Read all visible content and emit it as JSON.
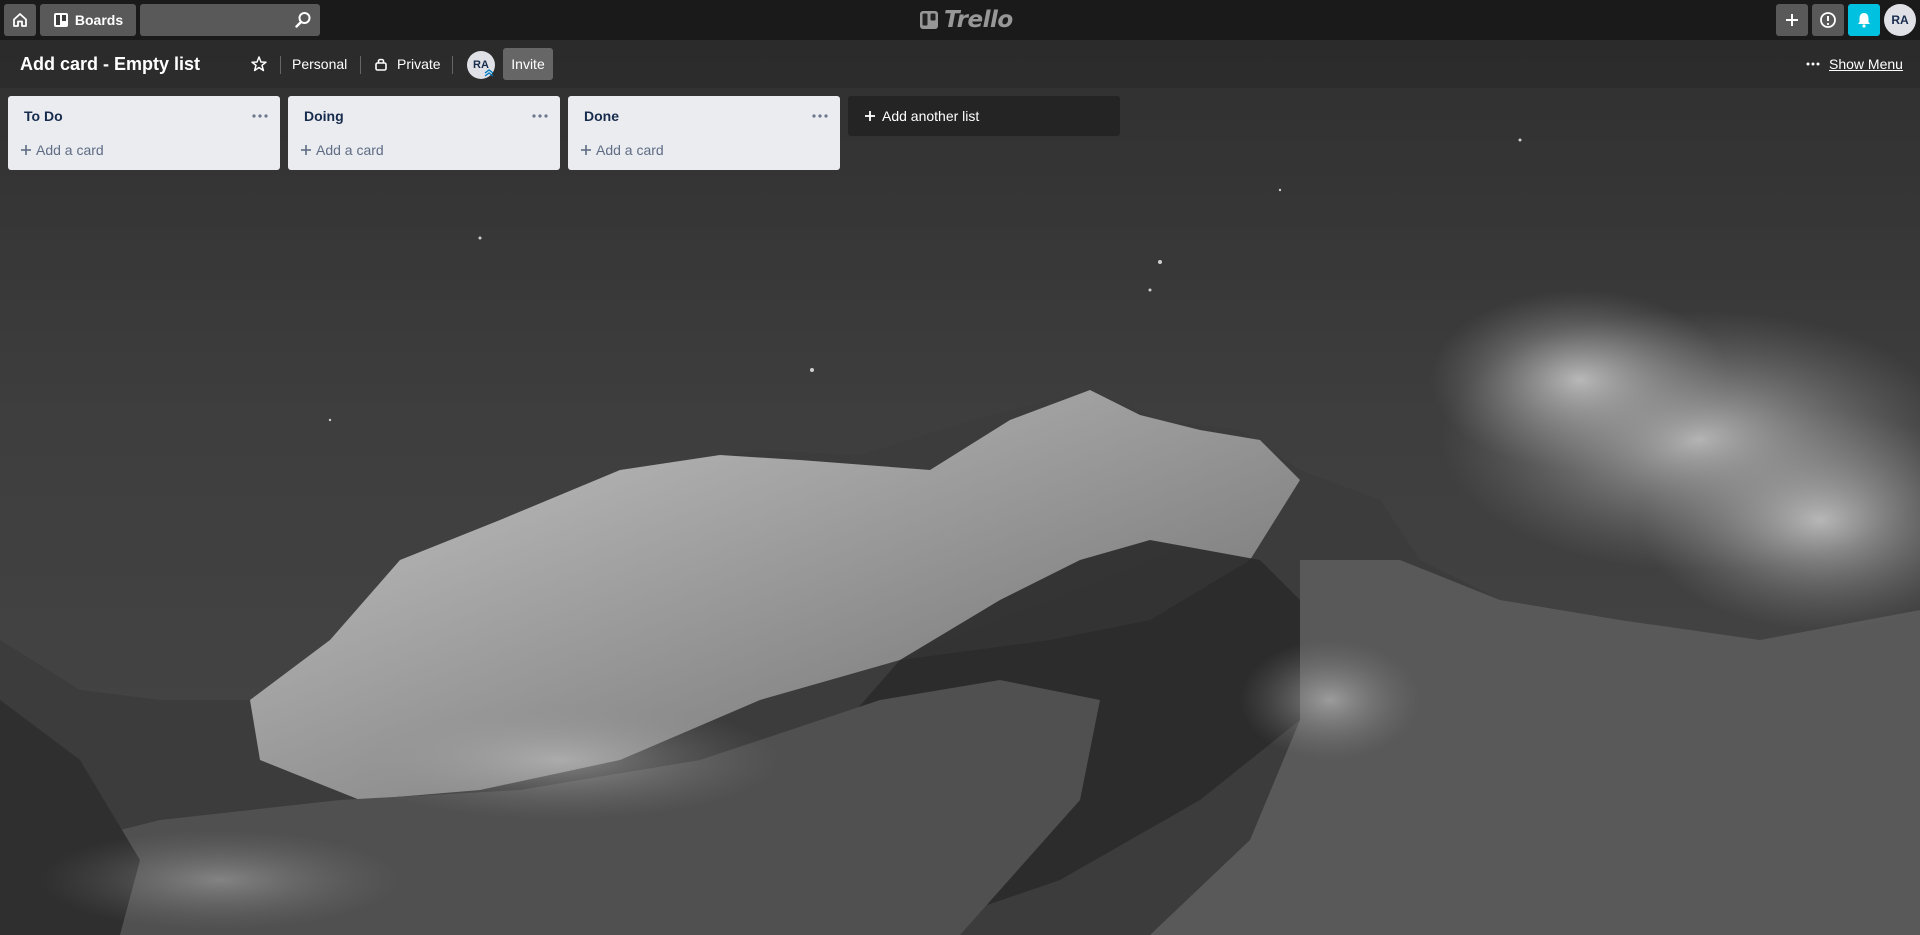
{
  "header": {
    "boards_label": "Boards",
    "search_placeholder": "",
    "logo_text": "Trello",
    "user_initials": "RA",
    "notification_color": "#00c2e0"
  },
  "board": {
    "title": "Add card - Empty list",
    "team": "Personal",
    "visibility": "Private",
    "member_initials": "RA",
    "invite_label": "Invite",
    "show_menu_label": "Show Menu"
  },
  "lists": [
    {
      "title": "To Do",
      "add_card_label": "Add a card"
    },
    {
      "title": "Doing",
      "add_card_label": "Add a card"
    },
    {
      "title": "Done",
      "add_card_label": "Add a card"
    }
  ],
  "add_list_label": "Add another list",
  "icons": {
    "home": "home-icon",
    "boards": "board-icon",
    "search": "search-icon",
    "add": "plus-icon",
    "info": "info-icon",
    "notifications": "bell-icon",
    "star": "star-icon",
    "lock": "lock-icon",
    "menu": "ellipsis-icon"
  }
}
